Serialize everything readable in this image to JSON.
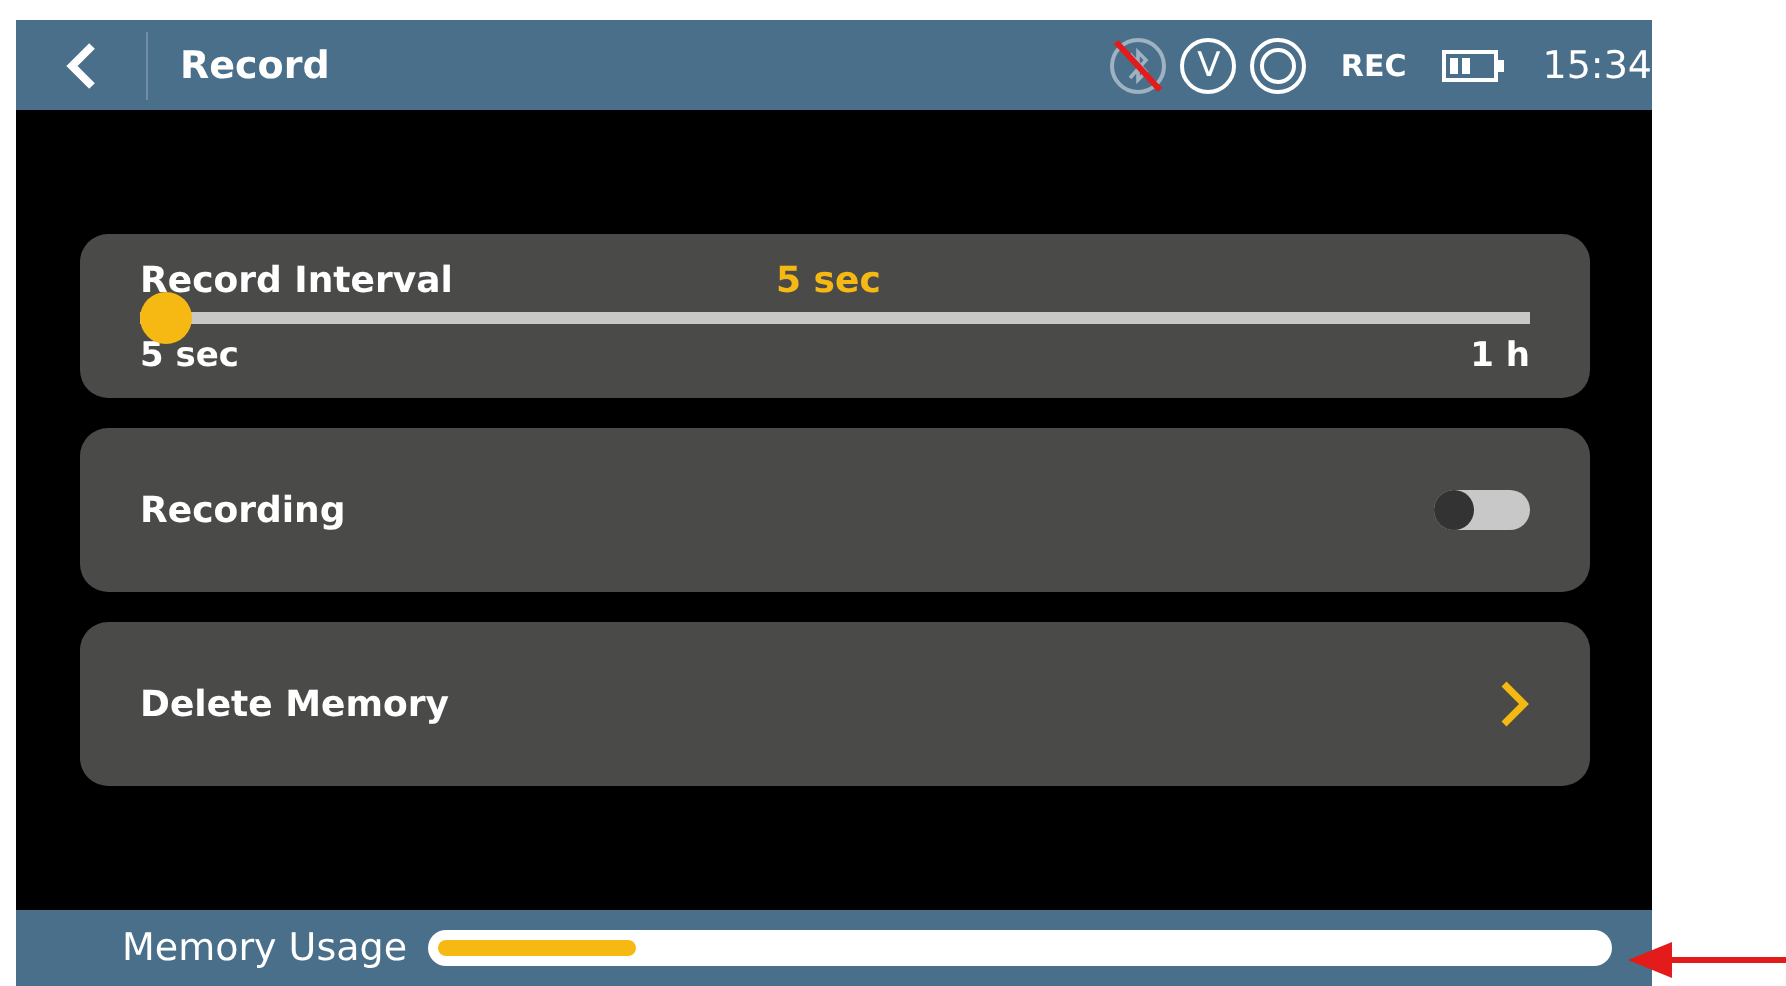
{
  "header": {
    "title": "Record",
    "status_icons": [
      {
        "kind": "bluetooth_off"
      },
      {
        "kind": "v",
        "label": "V"
      },
      {
        "kind": "record"
      }
    ],
    "rec_label": "REC",
    "time": "15:34"
  },
  "settings": [
    {
      "kind": "slider",
      "label": "Record Interval",
      "value": "5 sec",
      "level": 0.0,
      "min_label": "5 sec",
      "max_label": "1 h"
    },
    {
      "kind": "toggle",
      "label": "Recording",
      "on": false
    },
    {
      "kind": "link",
      "label": "Delete Memory"
    }
  ],
  "footer": {
    "label": "Memory Usage",
    "level": 0.17
  }
}
